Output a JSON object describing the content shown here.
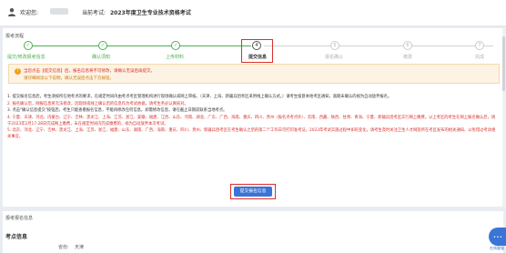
{
  "header": {
    "welcome_label": "欢迎您:",
    "exam_label": "当前考试:",
    "exam_name": "2023年度卫生专业技术资格考试",
    "icon": "user-icon"
  },
  "process": {
    "title": "报考流程",
    "steps": [
      {
        "num": "✓",
        "label": "提交/修改报考信息",
        "state": "done"
      },
      {
        "num": "✓",
        "label": "确认须知",
        "state": "done"
      },
      {
        "num": "✓",
        "label": "上传材料",
        "state": "done"
      },
      {
        "num": "4",
        "label": "提交信息",
        "state": "current"
      },
      {
        "num": "5",
        "label": "报名确认",
        "state": "todo"
      },
      {
        "num": "6",
        "label": "缴费",
        "state": "todo"
      },
      {
        "num": "7",
        "label": "完成",
        "state": "todo"
      }
    ],
    "done_color": "#4caf50",
    "current_highlight": "#d9302b"
  },
  "alert": {
    "line1": "当您点击【提交信息】后，报名信息将不可修改，请确认无误后再提交。",
    "line2": "请仔细阅读以下说明，确认无误后点击下方按钮。"
  },
  "notice": {
    "p1": "1. 提交报名信息后，考生须按所在地考点的要求，在规定时间内由考点考区管理机构进行现场确认或网上审核。（天津、上海、新疆兵团考区采用线上确认方式。）请考生留意本地考区通知，逾期未确认的视为自动放弃报名。",
    "p2": "2. 报名确认后，网报信息将无法修改，因现场或线上确认后的信息作为考试依据，请考生务必认真核对。",
    "p3": "3. 点击\"确认信息提交\"按钮后，考生只能查看报名信息，不能再修改任何信息。如需修改信息，请在截止日期前联系当地考点。",
    "p4": "4. 宁夏、天津、河北、内蒙古、辽宁、吉林、黑龙江、上海、江苏、浙江、安徽、福建、江西、山东、河南、湖北、广东、广西、海南、重庆、四川、贵州（报名点考点外）、云南、西藏、陕西、甘肃、青海、宁夏、新疆兵团考区实行网上缴费。以上考区的考生在网上报名确认后，请于2023年2月17-28日完成网上缴费，未在规定时间内完成缴费的，视为自动放弃本次考试。",
    "p5": "5. 北京、河北、辽宁、吉林、黑龙江、上海、江苏、浙江、福建、山东、湖南、广西、海南、重庆、四川、贵州、新疆兵团考区在考生确认之后的第二个工作日可打印准考证。2023年考试实施过程中如有变化，请考生及时关注卫生人才网及所在考区发布的相关通知，以免错过考试相关事宜。"
  },
  "confirm": {
    "label": "提交报名信息"
  },
  "info": {
    "section_title": "报考报名信息",
    "title": "考点信息",
    "row_label": "省份:",
    "row_value": "天津"
  },
  "chat": {
    "icon": "chat-icon",
    "label": "在线客服"
  }
}
